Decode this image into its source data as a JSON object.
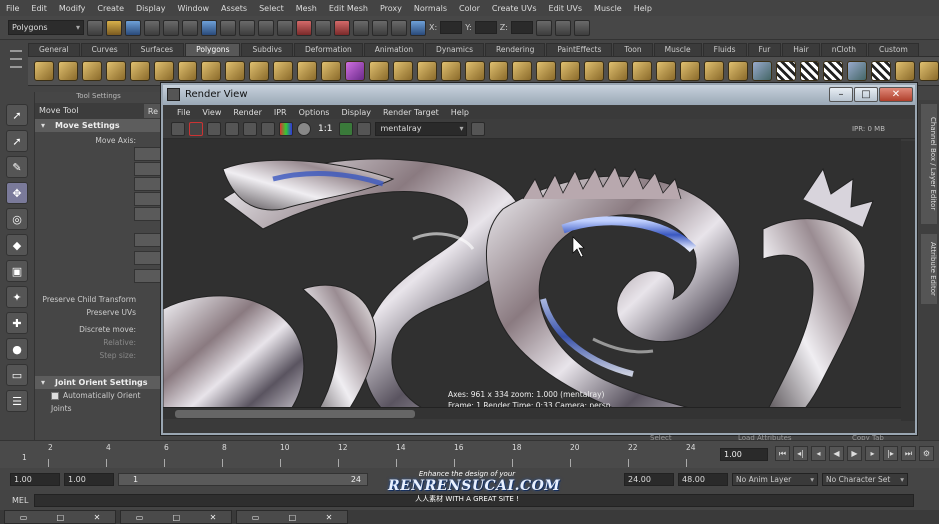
{
  "menubar": {
    "items": [
      "File",
      "Edit",
      "Modify",
      "Create",
      "Display",
      "Window",
      "Assets",
      "Select",
      "Mesh",
      "Edit Mesh",
      "Proxy",
      "Normals",
      "Color",
      "Create UVs",
      "Edit UVs",
      "Muscle",
      "Help"
    ]
  },
  "statusline": {
    "mode": "Polygons",
    "x_label": "X:",
    "y_label": "Y:",
    "z_label": "Z:"
  },
  "shelf": {
    "tabs": [
      "General",
      "Curves",
      "Surfaces",
      "Polygons",
      "Subdivs",
      "Deformation",
      "Animation",
      "Dynamics",
      "Rendering",
      "PaintEffects",
      "Toon",
      "Muscle",
      "Fluids",
      "Fur",
      "Hair",
      "nCloth",
      "Custom"
    ],
    "active_tab": "Polygons"
  },
  "tool_settings": {
    "panel_title": "Tool Settings",
    "tool_name": "Move Tool",
    "reset_label": "Re",
    "move_settings": {
      "header": "Move Settings",
      "move_axis_label": "Move Axis:",
      "preserve_child_transform": "Preserve Child Transform",
      "preserve_uvs": "Preserve UVs",
      "discrete_move": "Discrete move:",
      "relative": "Relative:",
      "step_size": "Step size:"
    },
    "joint_orient": {
      "header": "Joint Orient Settings",
      "auto_orient": "Automatically Orient Joints"
    }
  },
  "render_view": {
    "title": "Render View",
    "menu": [
      "File",
      "View",
      "Render",
      "IPR",
      "Options",
      "Display",
      "Render Target",
      "Help"
    ],
    "ratio": "1:1",
    "renderer": "mentalray",
    "ipr_status": "IPR: 0 MB",
    "info": {
      "line1": "Axes: 961 x 334  zoom: 1.000  (mentalray)",
      "line2": "Frame: 1    Render Time: 0:33    Camera: persp"
    }
  },
  "right_tabs": [
    "Channel Box / Layer Editor",
    "Attribute Editor"
  ],
  "side_labels": [
    "Select",
    "Load Attributes",
    "Copy Tab"
  ],
  "timeline": {
    "ticks": [
      "1",
      "2",
      "4",
      "6",
      "8",
      "10",
      "12",
      "14",
      "16",
      "18",
      "20",
      "22",
      "24"
    ],
    "current_frame": "1.00"
  },
  "range": {
    "start": "1.00",
    "anim_start": "1.00",
    "slider_start": "1",
    "slider_end": "24",
    "anim_end": "24.00",
    "end": "48.00",
    "anim_layer": "No Anim Layer",
    "char_set": "No Character Set"
  },
  "cmdline": {
    "label": "MEL"
  },
  "watermark": {
    "line1": "Enhance the design of your",
    "line2": "RENRENSUCAI.COM",
    "line3": "人人素材  WITH A GREAT SITE !"
  },
  "colors": {
    "background": "#444444",
    "titlebar": "#9aa8b6",
    "close": "#b0402c",
    "accent": "#7a7a9a"
  }
}
